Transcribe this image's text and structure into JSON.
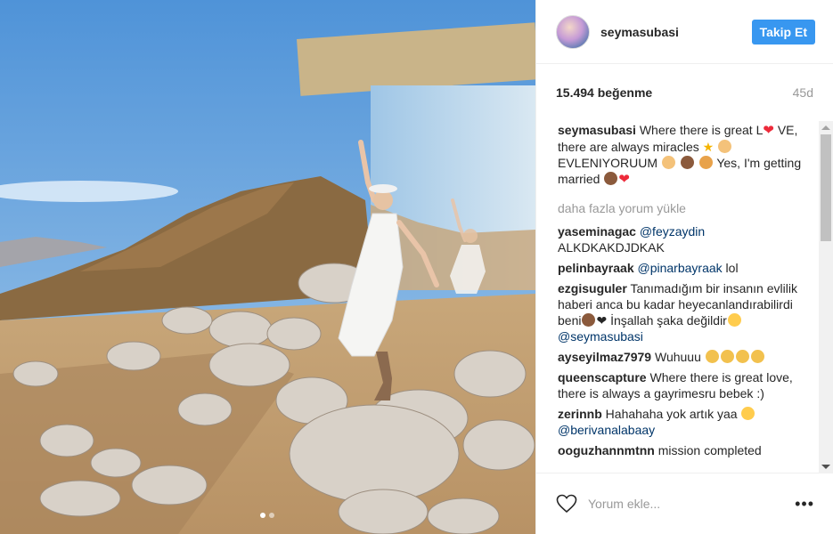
{
  "header": {
    "username": "seymasubasi",
    "follow_label": "Takip Et"
  },
  "stats": {
    "likes": "15.494 beğenme",
    "age": "45d"
  },
  "caption": {
    "username": "seymasubasi",
    "text_1": "Where there is great L",
    "text_2": "VE, there are always miracles",
    "text_3": "EVLENIYORUUM",
    "text_4": "Yes, I'm getting married"
  },
  "load_more": "daha fazla yorum yükle",
  "comments": [
    {
      "user": "yaseminagac",
      "mention": "@feyzaydin",
      "text": "ALKDKAKDJDKAK"
    },
    {
      "user": "pelinbayraak",
      "mention": "@pinarbayraak",
      "text": "lol"
    },
    {
      "user": "ezgisuguler",
      "text": "Tanımadığım bir insanın evlilik haberi anca bu kadar heyecanlandırabilirdi beni",
      "text2": "İnşallah şaka değildir",
      "mention": "@seymasubasi"
    },
    {
      "user": "ayseyilmaz7979",
      "text": "Wuhuuu"
    },
    {
      "user": "queenscapture",
      "text": "Where there is great love, there is always a gayrimesru bebek :)"
    },
    {
      "user": "zerinnb",
      "text": "Hahahaha yok artık yaa",
      "mention": "@berivanalabaay"
    },
    {
      "user": "ooguzhannmtnn",
      "text": "mission completed"
    }
  ],
  "add_comment": {
    "placeholder": "Yorum ekle...",
    "more": "•••"
  },
  "carousel": {
    "count": 2,
    "active": 0
  },
  "colors": {
    "accent": "#3897f0",
    "heart": "#ed2a3a",
    "muted": "#999999",
    "mention": "#003569"
  },
  "icons": [
    "heart-outline-icon",
    "more-options-icon",
    "red-heart-emoji",
    "star-emoji",
    "monkey-emoji",
    "couple-emoji",
    "clap-emoji",
    "laugh-emoji"
  ]
}
